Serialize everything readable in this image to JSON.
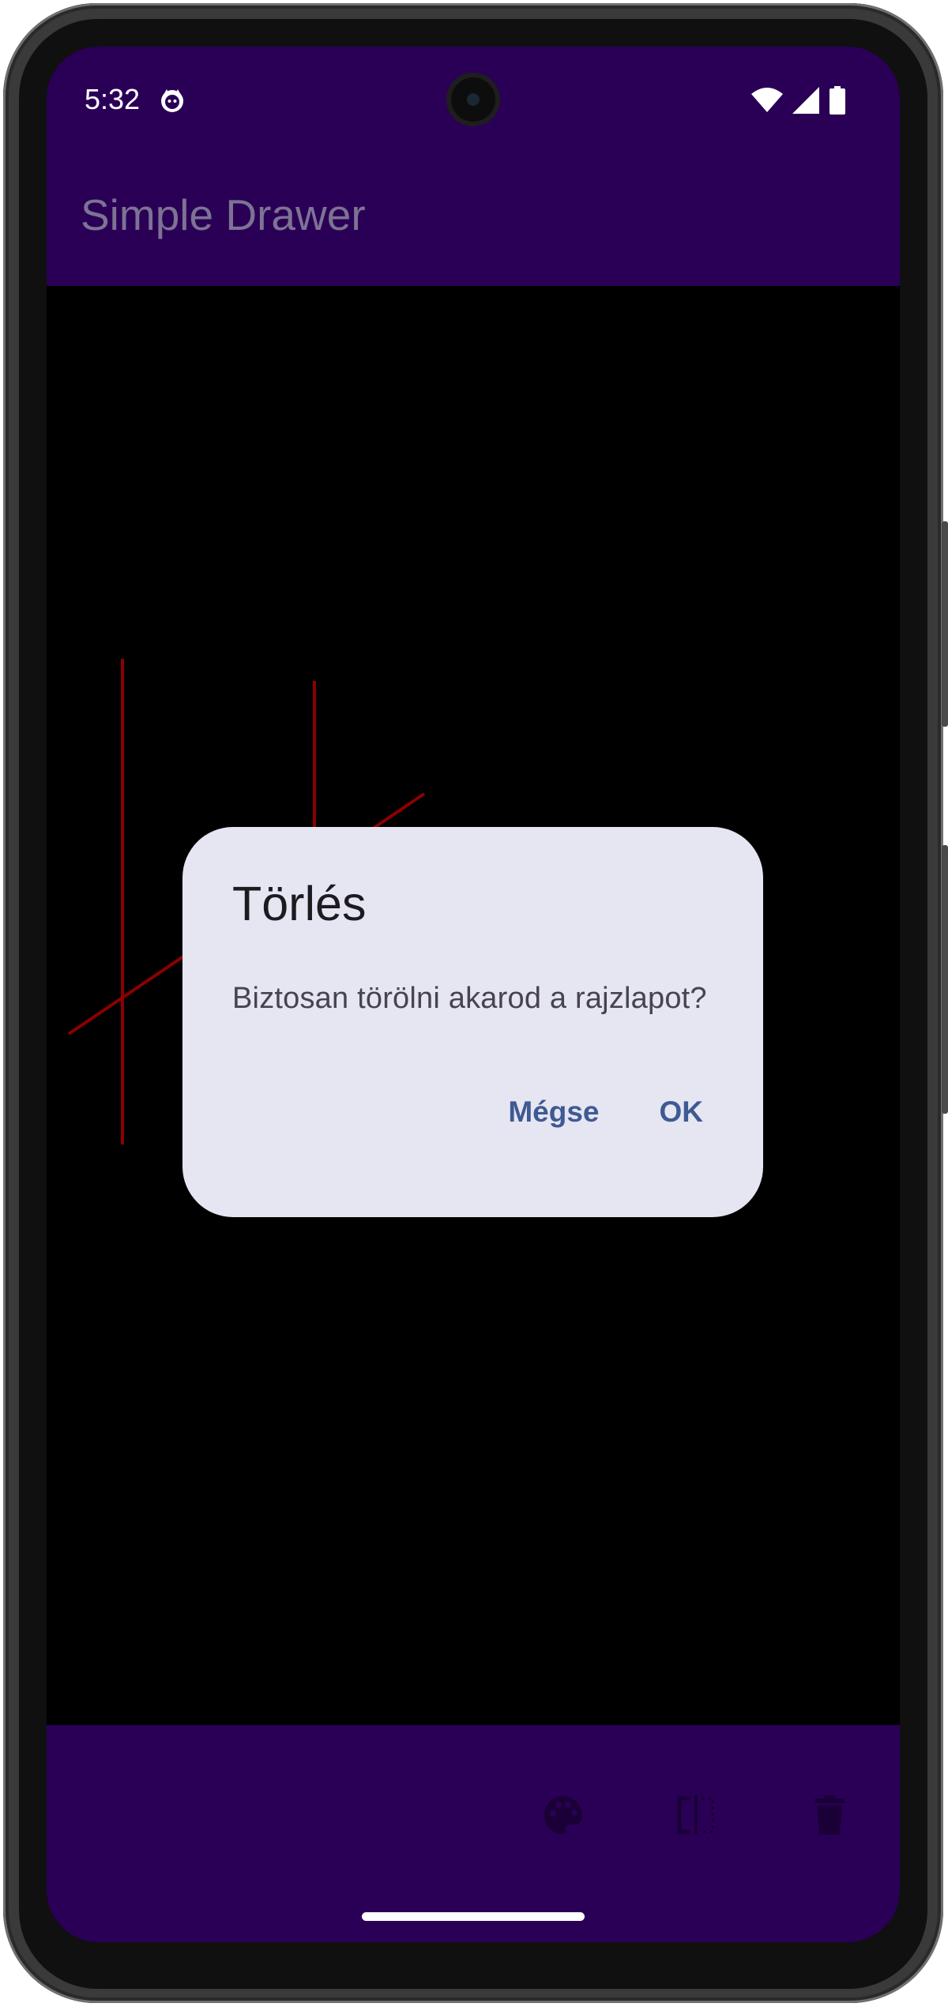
{
  "status_bar": {
    "time": "5:32",
    "icons": [
      "cat-notification-icon",
      "wifi-icon",
      "cellular-signal-icon",
      "battery-icon"
    ]
  },
  "app_bar": {
    "title": "Simple Drawer"
  },
  "canvas": {
    "stroke_color": "#8b0000",
    "background": "#000000"
  },
  "bottom_bar": {
    "actions": [
      "palette-icon",
      "mirror-icon",
      "delete-icon"
    ]
  },
  "dialog": {
    "title": "Törlés",
    "message": "Biztosan törölni akarod a rajzlapot?",
    "cancel_label": "Mégse",
    "ok_label": "OK"
  },
  "colors": {
    "primary_dark": "#2a0057",
    "dialog_surface": "#e6e5f2",
    "dialog_button": "#3f5a92"
  }
}
